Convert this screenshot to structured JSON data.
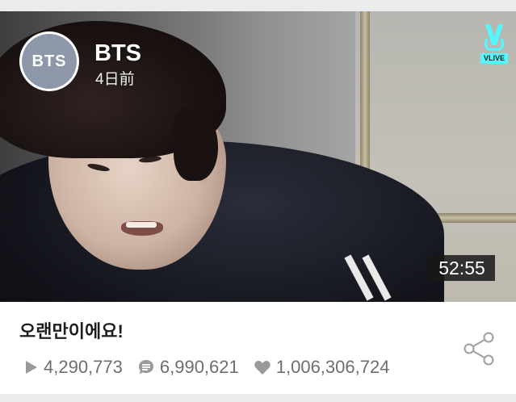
{
  "channel": {
    "avatar_text": "BTS",
    "name": "BTS",
    "posted_ago": "4日前"
  },
  "brand": {
    "logo_icon": "vlive-v-hand-icon",
    "badge_text": "VLIVE",
    "accent": "#54f7ff"
  },
  "video": {
    "duration": "52:55",
    "title": "오랜만이에요!"
  },
  "stats": {
    "plays": "4,290,773",
    "comments": "6,990,621",
    "likes": "1,006,306,724"
  },
  "icons": {
    "plays": "play-icon",
    "comments": "comment-icon",
    "likes": "heart-icon",
    "share": "share-icon"
  }
}
